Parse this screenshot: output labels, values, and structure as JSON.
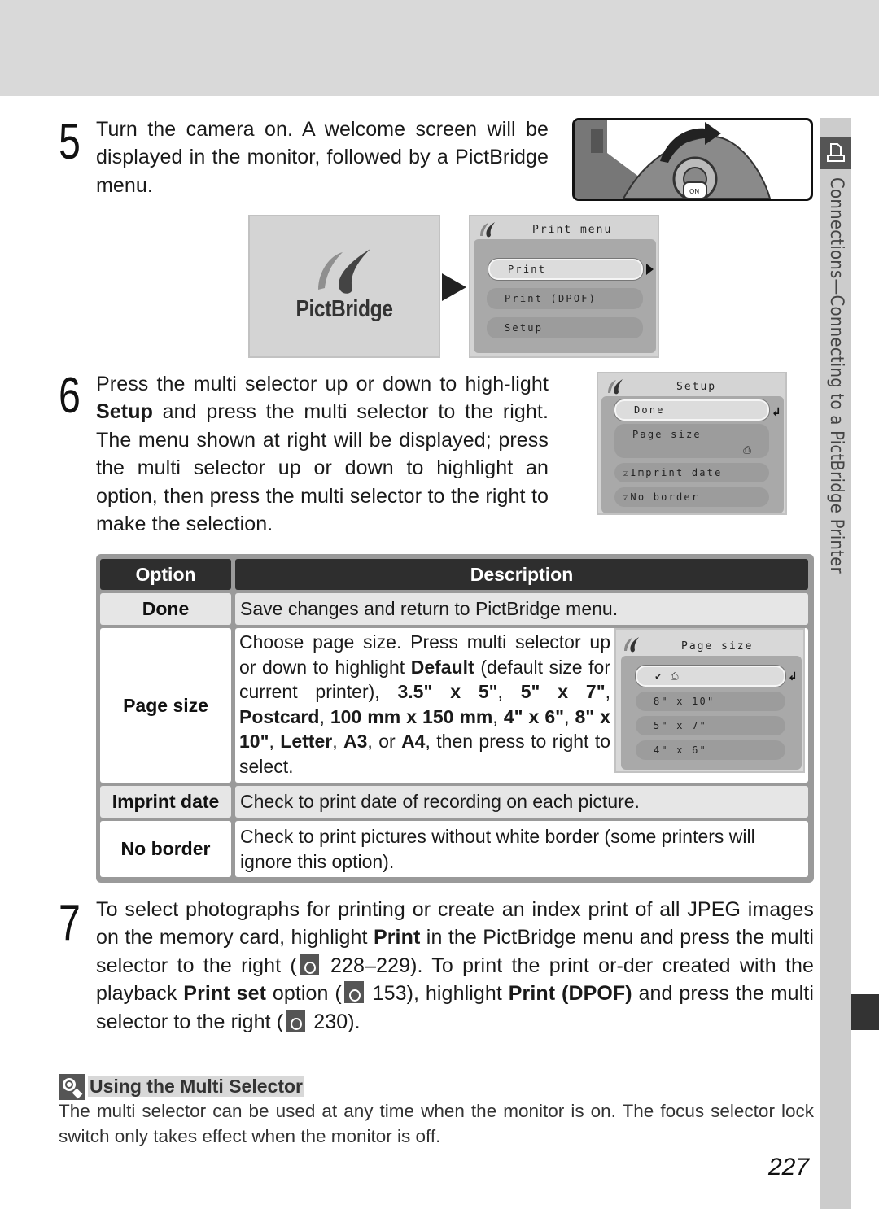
{
  "side_tab": {
    "section_label": "Connections—Connecting to a PictBridge Printer",
    "icon": "printer-icon"
  },
  "step5": {
    "number": "5",
    "text": "Turn the camera on.  A welcome screen will be displayed in the monitor, followed by a PictBridge menu.",
    "image": "camera-power-switch-illustration",
    "welcome_screen": {
      "logo_text": "PictBridge"
    },
    "print_menu": {
      "title": "Print menu",
      "items": [
        {
          "label": "Print",
          "selected": true
        },
        {
          "label": "Print (DPOF)",
          "selected": false
        },
        {
          "label": "Setup",
          "selected": false
        }
      ]
    }
  },
  "step6": {
    "number": "6",
    "text_before": "Press the multi selector up or down to high-light ",
    "bold": "Setup",
    "text_after": " and press the multi selector to the right.  The menu shown at right will be displayed; press the multi selector up or down to highlight an option, then press the multi selector to the right to make the selection.",
    "setup_menu": {
      "title": "Setup",
      "items": [
        {
          "label": "Done",
          "selected": true
        },
        {
          "label": "Page size",
          "selected": false
        },
        {
          "label": "☑Imprint date",
          "selected": false
        },
        {
          "label": "☑No border",
          "selected": false
        }
      ]
    }
  },
  "table": {
    "headers": [
      "Option",
      "Description"
    ],
    "rows": [
      {
        "option": "Done",
        "description": "Save changes and return to PictBridge menu."
      },
      {
        "option": "Page size",
        "description_parts": [
          {
            "t": "Choose page size.  Press multi selector up or down to highlight ",
            "b": false
          },
          {
            "t": "Default",
            "b": true
          },
          {
            "t": " (default size for current printer), ",
            "b": false
          },
          {
            "t": "3.5\" x 5\"",
            "b": true
          },
          {
            "t": ", ",
            "b": false
          },
          {
            "t": "5\" x 7\"",
            "b": true
          },
          {
            "t": ", ",
            "b": false
          },
          {
            "t": "Postcard",
            "b": true
          },
          {
            "t": ", ",
            "b": false
          },
          {
            "t": "100 mm x 150 mm",
            "b": true
          },
          {
            "t": ", ",
            "b": false
          },
          {
            "t": "4\" x 6\"",
            "b": true
          },
          {
            "t": ", ",
            "b": false
          },
          {
            "t": "8\" x 10\"",
            "b": true
          },
          {
            "t": ", ",
            "b": false
          },
          {
            "t": "Letter",
            "b": true
          },
          {
            "t": ", ",
            "b": false
          },
          {
            "t": "A3",
            "b": true
          },
          {
            "t": ", or ",
            "b": false
          },
          {
            "t": "A4",
            "b": true
          },
          {
            "t": ", then press to right to select.",
            "b": false
          }
        ],
        "page_size_menu": {
          "title": "Page size",
          "items": [
            {
              "label": "✔        ⎙",
              "selected": true
            },
            {
              "label": "8\" x 10\"",
              "selected": false
            },
            {
              "label": "5\" x 7\"",
              "selected": false
            },
            {
              "label": "4\" x 6\"",
              "selected": false
            }
          ]
        }
      },
      {
        "option": "Imprint date",
        "description": "Check to print date of recording on each picture."
      },
      {
        "option": "No border",
        "description": "Check to print pictures without white border (some printers will ignore this option)."
      }
    ]
  },
  "step7": {
    "number": "7",
    "parts": [
      {
        "t": "To select photographs for printing or create an index print of all JPEG images on the memory card, highlight ",
        "b": false
      },
      {
        "t": "Print",
        "b": true
      },
      {
        "t": " in the PictBridge menu and press the multi selector to the right (",
        "b": false
      },
      {
        "icon": "reference-icon"
      },
      {
        "t": " 228–229).  To print the print or-der created with the playback ",
        "b": false
      },
      {
        "t": "Print set",
        "b": true
      },
      {
        "t": " option (",
        "b": false
      },
      {
        "icon": "reference-icon"
      },
      {
        "t": " 153), highlight ",
        "b": false
      },
      {
        "t": "Print (DPOF)",
        "b": true
      },
      {
        "t": " and press the multi selector to the right (",
        "b": false
      },
      {
        "icon": "reference-icon"
      },
      {
        "t": " 230).",
        "b": false
      }
    ]
  },
  "tip": {
    "title": "Using the Multi Selector",
    "body": "The multi selector can be used at any time when the monitor is on.  The focus selector lock switch only takes effect when the monitor is off."
  },
  "page_number": "227"
}
